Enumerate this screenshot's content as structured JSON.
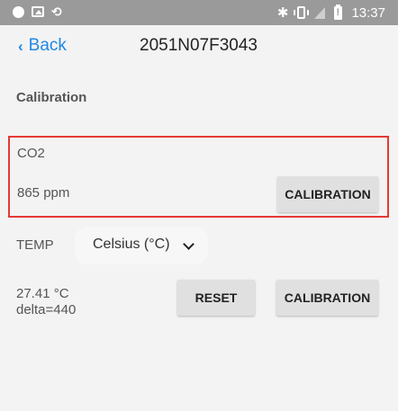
{
  "status_bar": {
    "time": "13:37",
    "left_icons": [
      "circle-icon",
      "image-icon",
      "sync-icon"
    ],
    "right_icons": [
      "bluetooth-icon",
      "vibrate-icon",
      "signal-icon",
      "battery-alert-icon"
    ]
  },
  "header": {
    "back_label": "Back",
    "title": "2051N07F3043"
  },
  "section_title": "Calibration",
  "co2": {
    "label": "CO2",
    "value": "865 ppm",
    "calibration_label": "CALIBRATION"
  },
  "temp": {
    "label": "TEMP",
    "unit_selected": "Celsius (°C)",
    "value": "27.41 °C",
    "delta": "delta=440",
    "reset_label": "RESET",
    "calibration_label": "CALIBRATION"
  },
  "colors": {
    "accent": "#1e88e5",
    "highlight_border": "#e53935",
    "status_bar": "#9a9a9a",
    "background": "#f3f3f3",
    "button": "#e0e0e0"
  }
}
